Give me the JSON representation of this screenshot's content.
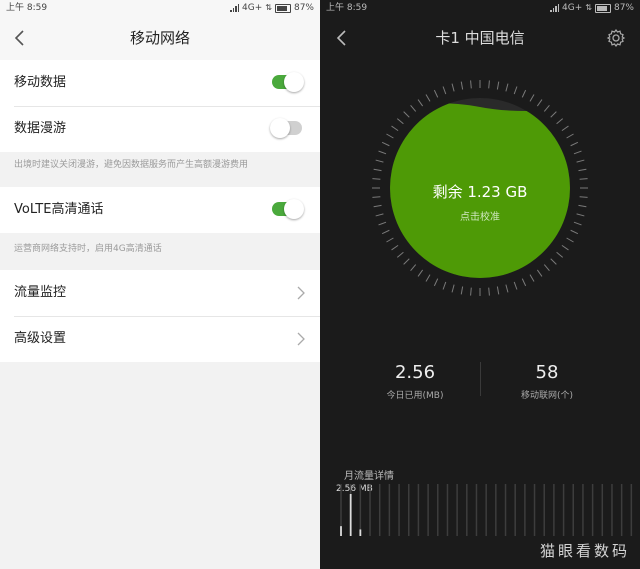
{
  "left": {
    "status": {
      "time": "上午 8:59",
      "network": "4G+",
      "battery": "87%"
    },
    "title": "移动网络",
    "rows": [
      {
        "label": "移动数据",
        "on": true
      },
      {
        "label": "数据漫游",
        "on": false
      }
    ],
    "roaming_hint": "出境时建议关闭漫游，避免因数据服务而产生高额漫游费用",
    "volte": {
      "label": "VoLTE高清通话",
      "on": true
    },
    "volte_hint": "运营商网络支持时，启用4G高清通话",
    "menu": [
      {
        "label": "流量监控"
      },
      {
        "label": "高级设置"
      }
    ]
  },
  "right": {
    "status": {
      "time": "上午 8:59",
      "network": "4G+",
      "battery": "87%"
    },
    "title": "卡1 中国电信",
    "remaining": "剩余 1.23 GB",
    "calibrate": "点击校准",
    "remaining_fraction": 0.95,
    "today_used": "2.56",
    "today_used_caption": "今日已用(MB)",
    "apps_count": "58",
    "apps_caption": "移动联网(个)",
    "monthly_title": "月流量详情",
    "bar_value_label": "2.56 MB",
    "daily_usage_mb": [
      0.6,
      2.56,
      0.4,
      0,
      0,
      0,
      0,
      0,
      0,
      0,
      0,
      0,
      0,
      0,
      0,
      0,
      0,
      0,
      0,
      0,
      0,
      0,
      0,
      0,
      0,
      0,
      0,
      0,
      0,
      0,
      0
    ],
    "accent": "#4e9a06"
  },
  "watermark": "猫眼看数码"
}
